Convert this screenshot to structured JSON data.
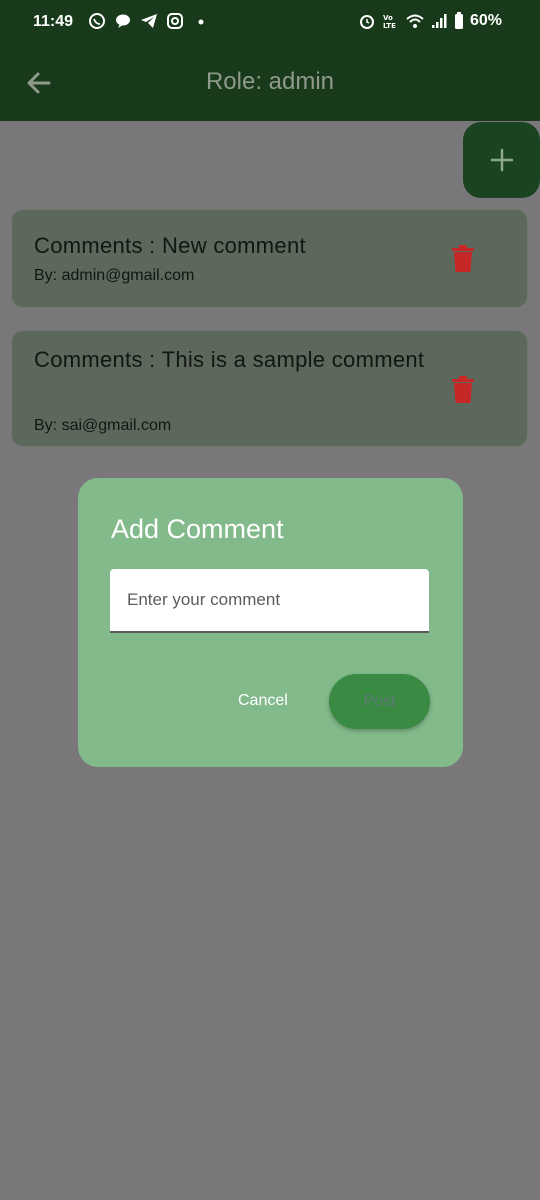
{
  "status_bar": {
    "time": "11:49",
    "battery": "60%",
    "left_icons": [
      "whatsapp-icon",
      "chat-bubble-icon",
      "telegram-icon",
      "instagram-icon",
      "dot-icon"
    ],
    "right_icons": [
      "alarm-icon",
      "volte-icon",
      "wifi-icon",
      "signal-icon",
      "battery-icon"
    ]
  },
  "app_bar": {
    "title": "Role: admin",
    "back_icon": "arrow-left-icon"
  },
  "fab": {
    "icon": "plus-icon"
  },
  "comments": [
    {
      "text": "Comments : New comment",
      "by": "By: admin@gmail.com",
      "delete_icon": "trash-icon"
    },
    {
      "text": "Comments : This is a sample comment",
      "by": "By: sai@gmail.com",
      "delete_icon": "trash-icon"
    }
  ],
  "dialog": {
    "title": "Add Comment",
    "input_placeholder": "Enter your comment",
    "input_value": "",
    "cancel_label": "Cancel",
    "post_label": "Post"
  },
  "colors": {
    "primary_dark": "#183a1a",
    "delete_red": "#c62828",
    "dialog_bg": "#82ba8b",
    "post_button": "#3a8a44"
  }
}
